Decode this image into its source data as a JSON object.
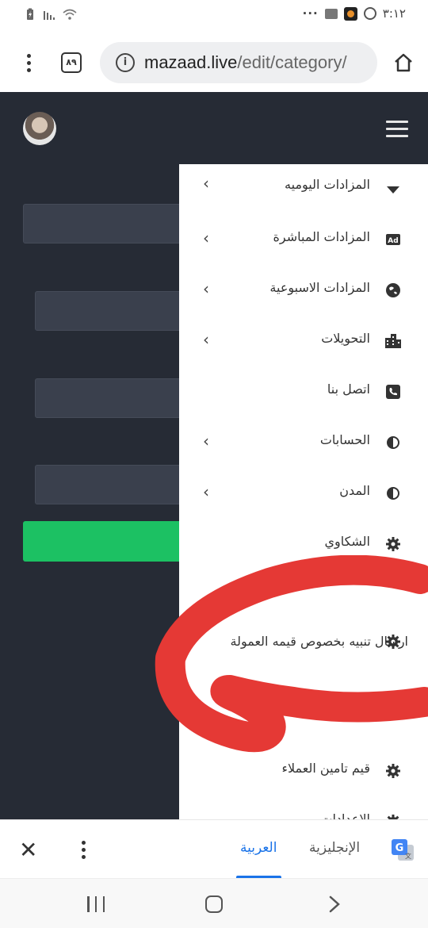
{
  "status_bar": {
    "time": "٣:١٢",
    "more": "···",
    "signal_icon": "signal-icon",
    "wifi_icon": "wifi-icon"
  },
  "browser": {
    "tab_count": "٨٩",
    "url_domain": "mazaad.live",
    "url_path": "/edit/category/"
  },
  "menu": {
    "items": [
      {
        "label": "المزادات اليوميه",
        "icon": "caret-down-icon",
        "has_chevron": true
      },
      {
        "label": "المزادات المباشرة",
        "icon": "ad-icon",
        "has_chevron": true
      },
      {
        "label": "المزادات الاسبوعية",
        "icon": "globe-icon",
        "has_chevron": true
      },
      {
        "label": "التحويلات",
        "icon": "building-icon",
        "has_chevron": true
      },
      {
        "label": "اتصل بنا",
        "icon": "phone-icon",
        "has_chevron": false
      },
      {
        "label": "الحسابات",
        "icon": "contrast-icon",
        "has_chevron": true
      },
      {
        "label": "المدن",
        "icon": "contrast-icon",
        "has_chevron": true
      },
      {
        "label": "الشكاوي",
        "icon": "gear-icon",
        "has_chevron": false
      },
      {
        "label": "ارسال تنبيه بخصوص قيمه العمولة",
        "icon": "gear-icon",
        "has_chevron": false
      },
      {
        "label": "قيم تامين العملاء",
        "icon": "gear-icon",
        "has_chevron": false
      },
      {
        "label": "الاعدادات",
        "icon": "gear-icon",
        "has_chevron": false
      }
    ]
  },
  "translate_bar": {
    "target_language": "العربية",
    "source_language": "الإنجليزية",
    "close_icon": "close-icon",
    "more_icon": "more-vert-icon",
    "logo_icon": "google-translate-icon"
  },
  "colors": {
    "page_bg": "#262b35",
    "accent_green": "#1cc163",
    "annotation_red": "#e53935",
    "translate_active": "#1a73e8"
  }
}
